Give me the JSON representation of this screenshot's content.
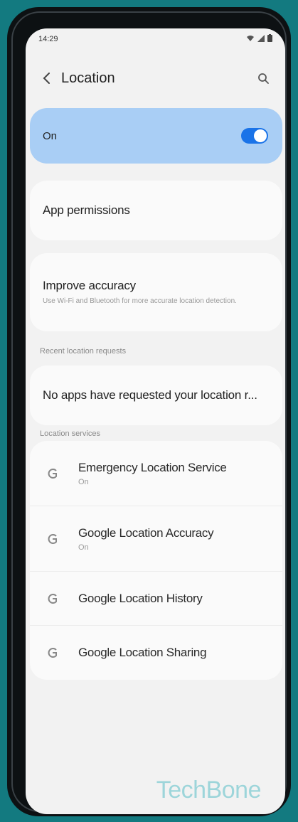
{
  "status_bar": {
    "time": "14:29",
    "icons": [
      "wifi-icon",
      "signal-icon",
      "battery-icon"
    ]
  },
  "app_bar": {
    "back_icon": "back-chevron-icon",
    "title": "Location",
    "search_icon": "search-icon"
  },
  "master_toggle": {
    "label": "On",
    "state": "on",
    "accent_color": "#1a73e8",
    "card_color": "#a9cef5"
  },
  "app_permissions": {
    "label": "App permissions"
  },
  "improve_accuracy": {
    "title": "Improve accuracy",
    "subtitle": "Use Wi-Fi and Bluetooth for more accurate location detection."
  },
  "recent_requests": {
    "header": "Recent location requests",
    "empty_text": "No apps have requested your location r..."
  },
  "location_services": {
    "header": "Location services",
    "items": [
      {
        "title": "Emergency Location Service",
        "subtitle": "On",
        "icon": "google-g-icon"
      },
      {
        "title": "Google Location Accuracy",
        "subtitle": "On",
        "icon": "google-g-icon"
      },
      {
        "title": "Google Location History",
        "subtitle": "",
        "icon": "google-g-icon"
      },
      {
        "title": "Google Location Sharing",
        "subtitle": "",
        "icon": "google-g-icon"
      }
    ]
  },
  "watermark": "TechBone"
}
